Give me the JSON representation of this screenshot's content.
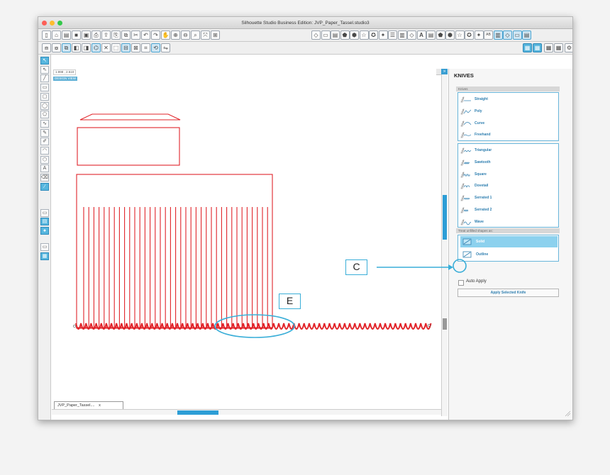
{
  "window": {
    "title": "Silhouette Studio Business Edition: JVP_Paper_Tassel.studio3",
    "traffic_lights": [
      "#fc5f57",
      "#fdbc2e",
      "#34c84a"
    ]
  },
  "toolbar1_icons": [
    "new-doc-icon",
    "open-icon",
    "template-icon",
    "save-icon",
    "save-as-icon",
    "print-icon",
    "send-icon",
    "copy-icon",
    "paste-icon",
    "cut-icon",
    "undo-icon",
    "redo-icon",
    "pan-icon",
    "zoom-in-icon",
    "zoom-out-icon",
    "zoom-box-icon",
    "zoom-fit-icon",
    "fit-page-icon"
  ],
  "toolbar1_right_icons": [
    "shape-tool-icon",
    "fill-icon",
    "line-icon",
    "fill-pattern-icon",
    "gradient-icon",
    "cut-style-icon",
    "star-icon",
    "rhinestone-icon",
    "sketch-icon",
    "line-style-icon",
    "offset-icon",
    "text-style-icon",
    "replicate-icon",
    "modify-icon",
    "trace-icon",
    "knife-icon",
    "pix-scan-icon",
    "library-icon",
    "store-icon",
    "send-panel-icon",
    "grid-icon",
    "page-icon",
    "settings-icon"
  ],
  "text_icon_glyph": "A",
  "ab_icon_glyph": "AB",
  "ruler": {
    "readout": "1.998 , 2.510"
  },
  "view_badge": "DESIGN VIEW",
  "doc_tab": {
    "label": "JVP_Paper_Tassel....",
    "close": "x"
  },
  "panel": {
    "title": "KNIVES",
    "knives_head": "Knives",
    "knives": [
      "Straight",
      "Poly",
      "Curve",
      "Freehand"
    ],
    "edge_knives": [
      "Triangular",
      "Sawtooth",
      "Square",
      "Dovetail",
      "Serrated 1",
      "Serrated 2",
      "Wave"
    ],
    "treat_head": "Treat unfilled shapes as:",
    "treat_options": [
      "Solid",
      "Outline"
    ],
    "auto_apply": "Auto Apply",
    "apply_button": "Apply Selected Knife"
  },
  "callouts": {
    "c": "C",
    "e": "E"
  },
  "colors": {
    "accent": "#3aaed8",
    "cut_line": "#e1242a",
    "selected": "#57b6de"
  }
}
